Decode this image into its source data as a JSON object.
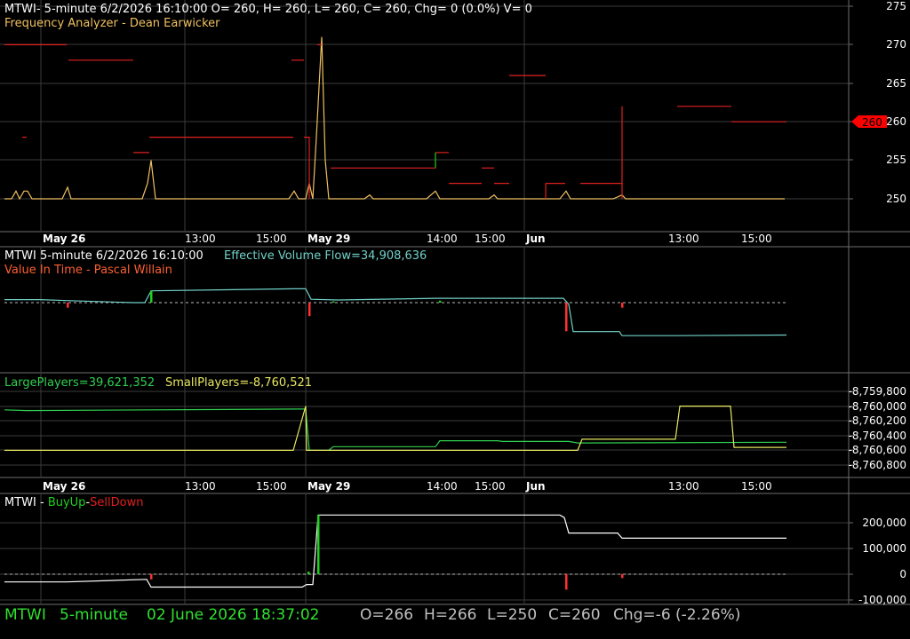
{
  "colors": {
    "background": "#000000",
    "grid": "#3c3c3c",
    "divider": "#6e6e6e",
    "axis_text": "#ffffff",
    "price_orange": "#f0c060",
    "price_red": "#e02020",
    "flow_cyan": "#70d0c8",
    "hist_green": "#20d020",
    "hist_red": "#ff3030",
    "large_green": "#30d050",
    "small_yellow": "#e8e860",
    "buysell_white": "#ffffff",
    "status_green": "#30e030",
    "status_gray": "#c0c0c0",
    "current_price_tag": "#ff0000"
  },
  "time_axis": {
    "labels": [
      "May 26",
      "13:00",
      "15:00",
      "May 29",
      "14:00",
      "15:00",
      "Jun",
      "13:00",
      "15:00"
    ]
  },
  "panes": {
    "price": {
      "header": "MTWI- 5-minute 6/2/2026 16:10:00 O= 260, H= 260, L= 260, C= 260, Chg= 0 (0.0%) V= 0",
      "subheader": "Frequency Analyzer - Dean Earwicker",
      "y_ticks": [
        "275",
        "270",
        "265",
        "260",
        "255",
        "250"
      ],
      "current_price_label": "260"
    },
    "flow": {
      "header_symbol": "MTWI 5-minute  6/2/2026 16:10:00",
      "header_indicator": "Effective Volume Flow=34,908,636",
      "subheader": "Value In Time - Pascal Willain"
    },
    "players": {
      "large_label": "LargePlayers=39,621,352",
      "small_label": "SmallPlayers=-8,760,521",
      "y_ticks": [
        "-8,759,800",
        "-8,760,000",
        "-8,760,200",
        "-8,760,400",
        "-8,760,600",
        "-8,760,800"
      ]
    },
    "buysell": {
      "prefix": "MTWI - ",
      "buy_label": "BuyUp",
      "sep": "-",
      "sell_label": "SellDown",
      "y_ticks": [
        "200,000",
        "100,000",
        "0",
        "-100,000"
      ]
    }
  },
  "status_bar": {
    "symbol": "MTWI",
    "interval": "5-minute",
    "datetime": "02 June 2026 18:37:02",
    "open": "O=266",
    "high": "H=266",
    "low": "L=250",
    "close": "C=260",
    "change": "Chg=-6 (-2.26%)"
  },
  "chart_data": [
    {
      "type": "line",
      "pane": "price",
      "ylim": [
        246,
        276
      ],
      "series": [
        {
          "name": "Frequency Analyzer",
          "segments": [
            [
              [
                5,
                250
              ],
              [
                13,
                250
              ],
              [
                18,
                251
              ],
              [
                22,
                250
              ],
              [
                27,
                251
              ],
              [
                31,
                251
              ],
              [
                36,
                250
              ],
              [
                45,
                250
              ],
              [
                70,
                250
              ],
              [
                76,
                251.5
              ],
              [
                80,
                250
              ],
              [
                150,
                250
              ],
              [
                160,
                250
              ],
              [
                166,
                252
              ],
              [
                170,
                255
              ],
              [
                175,
                250
              ],
              [
                200,
                250
              ],
              [
                325,
                250
              ],
              [
                331,
                251
              ],
              [
                336,
                250
              ],
              [
                340,
                250
              ],
              [
                344,
                250
              ],
              [
                348,
                252
              ],
              [
                352,
                250
              ],
              [
                356,
                258
              ],
              [
                362,
                271
              ],
              [
                366,
                255
              ],
              [
                370,
                250
              ],
              [
                375,
                250
              ],
              [
                410,
                250
              ],
              [
                416,
                250.5
              ],
              [
                420,
                250
              ],
              [
                480,
                250
              ],
              [
                490,
                251
              ],
              [
                495,
                250
              ],
              [
                550,
                250
              ],
              [
                556,
                250.5
              ],
              [
                560,
                250
              ],
              [
                600,
                250
              ],
              [
                630,
                250
              ],
              [
                637,
                251
              ],
              [
                642,
                250
              ],
              [
                690,
                250
              ],
              [
                700,
                250.5
              ],
              [
                704,
                250
              ],
              [
                883,
                250
              ]
            ]
          ]
        },
        {
          "name": "price_red",
          "segments": [
            [
              [
                5,
                270
              ],
              [
                75,
                270
              ]
            ],
            [
              [
                77,
                268
              ],
              [
                150,
                268
              ]
            ],
            [
              [
                25,
                258
              ],
              [
                30,
                258
              ]
            ],
            [
              [
                150,
                256
              ],
              [
                168,
                256
              ]
            ],
            [
              [
                168,
                258
              ],
              [
                330,
                258
              ]
            ],
            [
              [
                328,
                268
              ],
              [
                342,
                268
              ]
            ],
            [
              [
                342,
                258
              ],
              [
                348,
                258
              ],
              [
                348,
                250
              ]
            ],
            [
              [
                357,
                270
              ],
              [
                362,
                270
              ]
            ],
            [
              [
                372,
                254
              ],
              [
                490,
                254
              ]
            ],
            [
              [
                490,
                256
              ],
              [
                505,
                256
              ]
            ],
            [
              [
                505,
                252
              ],
              [
                542,
                252
              ]
            ],
            [
              [
                542,
                254
              ],
              [
                556,
                254
              ]
            ],
            [
              [
                556,
                252
              ],
              [
                573,
                252
              ]
            ],
            [
              [
                573,
                266
              ],
              [
                614,
                266
              ]
            ],
            [
              [
                614,
                252
              ],
              [
                614,
                250
              ]
            ],
            [
              [
                614,
                252
              ],
              [
                636,
                252
              ]
            ],
            [
              [
                653,
                252
              ],
              [
                700,
                252
              ],
              [
                700,
                262
              ],
              [
                700,
                250
              ]
            ],
            [
              [
                762,
                262
              ],
              [
                823,
                262
              ]
            ],
            [
              [
                823,
                260
              ],
              [
                885,
                260
              ]
            ]
          ]
        },
        {
          "name": "price_green_step",
          "segments": [
            [
              [
                490,
                256
              ],
              [
                490,
                254
              ]
            ]
          ]
        }
      ]
    },
    {
      "type": "line",
      "pane": "flow",
      "ylim": [
        -100,
        100
      ],
      "series": [
        {
          "name": "Effective Volume Flow",
          "segments": [
            [
              [
                5,
                0.09
              ],
              [
                45,
                0.09
              ],
              [
                75,
                0.06
              ],
              [
                150,
                0
              ],
              [
                163,
                0
              ],
              [
                170,
                0.35
              ],
              [
                330,
                0.41
              ],
              [
                344,
                0.41
              ],
              [
                350,
                0.1
              ],
              [
                380,
                0.08
              ],
              [
                490,
                0.13
              ],
              [
                580,
                0.13
              ],
              [
                634,
                0.13
              ],
              [
                640,
                -0.05
              ],
              [
                645,
                -0.86
              ],
              [
                697,
                -0.86
              ],
              [
                700,
                -0.98
              ],
              [
                760,
                -0.98
              ],
              [
                885,
                -0.96
              ]
            ]
          ]
        },
        {
          "name": "histogram_positive",
          "bars": [
            [
              170,
              0.35
            ],
            [
              495,
              0.06
            ],
            [
              375,
              0.04
            ]
          ]
        },
        {
          "name": "histogram_negative",
          "bars": [
            [
              76,
              -0.15
            ],
            [
              348,
              -0.4
            ],
            [
              637,
              -0.85
            ],
            [
              700,
              -0.15
            ]
          ]
        }
      ]
    },
    {
      "type": "line",
      "pane": "players",
      "ylim": [
        -8760750,
        -8759850
      ],
      "series": [
        {
          "name": "LargePlayers",
          "segments": [
            [
              [
                5,
                -8760050
              ],
              [
                30,
                -8760060
              ],
              [
                335,
                -8760040
              ],
              [
                344,
                -8760040
              ],
              [
                348,
                -8760600
              ],
              [
                370,
                -8760600
              ],
              [
                375,
                -8760550
              ],
              [
                490,
                -8760550
              ],
              [
                495,
                -8760470
              ],
              [
                560,
                -8760470
              ],
              [
                565,
                -8760480
              ],
              [
                640,
                -8760480
              ],
              [
                650,
                -8760500
              ],
              [
                885,
                -8760490
              ]
            ]
          ]
        },
        {
          "name": "SmallPlayers",
          "segments": [
            [
              [
                5,
                -8760600
              ],
              [
                330,
                -8760600
              ],
              [
                344,
                -8760000
              ],
              [
                345,
                -8760600
              ],
              [
                650,
                -8760600
              ],
              [
                655,
                -8760450
              ],
              [
                760,
                -8760450
              ],
              [
                765,
                -8760000
              ],
              [
                822,
                -8760000
              ],
              [
                826,
                -8760560
              ],
              [
                885,
                -8760560
              ]
            ]
          ]
        }
      ]
    },
    {
      "type": "line",
      "pane": "buysell",
      "ylim": [
        -110000,
        260000
      ],
      "series": [
        {
          "name": "BuyUp-SellDown",
          "segments": [
            [
              [
                5,
                -30000
              ],
              [
                75,
                -30000
              ],
              [
                165,
                -20000
              ],
              [
                170,
                -50000
              ],
              [
                340,
                -50000
              ],
              [
                345,
                -40000
              ],
              [
                352,
                -40000
              ],
              [
                358,
                230000
              ],
              [
                630,
                230000
              ],
              [
                635,
                220000
              ],
              [
                640,
                160000
              ],
              [
                695,
                160000
              ],
              [
                700,
                140000
              ],
              [
                885,
                140000
              ]
            ]
          ]
        },
        {
          "name": "buy_green",
          "bars": [
            [
              358,
              230000
            ],
            [
              347,
              10000
            ]
          ]
        },
        {
          "name": "sell_red",
          "bars": [
            [
              170,
              -20000
            ],
            [
              637,
              -60000
            ],
            [
              700,
              -15000
            ]
          ]
        }
      ]
    }
  ]
}
